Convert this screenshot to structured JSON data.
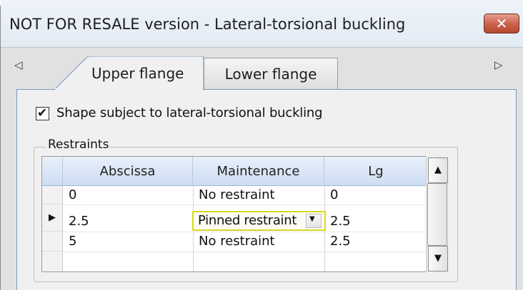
{
  "window": {
    "title": "NOT FOR RESALE version - Lateral-torsional buckling",
    "close_glyph": "✕"
  },
  "tab_scroll": {
    "left_glyph": "◁",
    "right_glyph": "▷"
  },
  "tabs": [
    {
      "label": "Upper flange",
      "active": true
    },
    {
      "label": "Lower flange",
      "active": false
    }
  ],
  "checkbox": {
    "label": "Shape subject to lateral-torsional buckling",
    "checked": true,
    "check_glyph": "✔"
  },
  "restraints": {
    "legend": "Restraints",
    "columns": [
      "Abscissa",
      "Maintenance",
      "Lg"
    ],
    "rows": [
      {
        "abscissa": "0",
        "maintenance": "No restraint",
        "lg": "0"
      },
      {
        "abscissa": "2.5",
        "maintenance": "Pinned restraint",
        "lg": "2.5",
        "current": true
      },
      {
        "abscissa": "5",
        "maintenance": "No restraint",
        "lg": "2.5"
      }
    ],
    "current_row_glyph": "▶",
    "dropdown_glyph": "▼"
  },
  "scrollbar": {
    "up_glyph": "▲",
    "down_glyph": "▼"
  },
  "colors": {
    "edit_highlight": "#d8d81c",
    "header_gradient_top": "#e9f0fa",
    "panel_border": "#7a98bf",
    "close_button": "#c9604a"
  }
}
